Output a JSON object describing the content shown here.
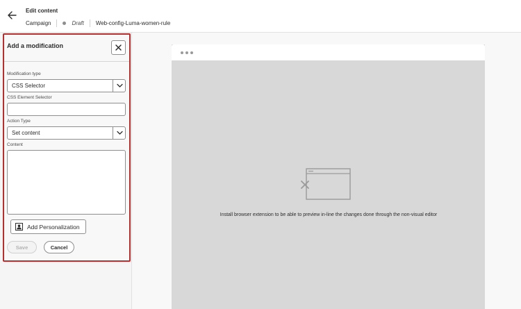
{
  "header": {
    "title": "Edit content",
    "breadcrumb": {
      "campaign": "Campaign",
      "status": "Draft",
      "name": "Web-config-Luma-women-rule"
    }
  },
  "panel": {
    "title": "Add a modification",
    "modification_type": {
      "label": "Modification type",
      "value": "CSS Selector"
    },
    "css_selector": {
      "label": "CSS Element Selector",
      "value": ""
    },
    "action_type": {
      "label": "Action Type",
      "value": "Set content"
    },
    "content": {
      "label": "Content",
      "value": ""
    },
    "personalization_label": "Add Personalization",
    "save_label": "Save",
    "cancel_label": "Cancel"
  },
  "preview": {
    "message": "Install browser extension to be able to preview in-line the changes done through the non-visual editor"
  },
  "colors": {
    "panel_highlight": "#b82e2e",
    "preview_background": "#d8d8d8"
  },
  "icons": [
    "back-arrow-icon",
    "close-icon",
    "chevron-down-icon",
    "personalization-icon",
    "broken-window-icon"
  ]
}
